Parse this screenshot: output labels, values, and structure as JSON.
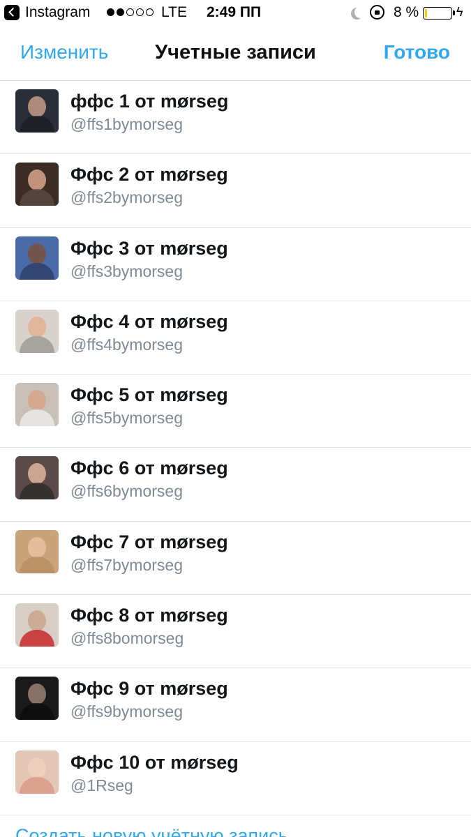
{
  "status_bar": {
    "back_app": "Instagram",
    "network": "LTE",
    "time": "2:49 ПП",
    "battery_percent": "8 %",
    "battery_level": 0.08,
    "charging_glyph": "ϟ",
    "icons": [
      "back-icon",
      "signal-icon",
      "moon-icon",
      "orientation-lock-icon",
      "battery-icon",
      "charging-icon"
    ]
  },
  "nav": {
    "edit": "Изменить",
    "title": "Учетные записи",
    "done": "Готово"
  },
  "accounts": [
    {
      "name": "ффс 1 от mørseg",
      "handle": "@ffs1bymorseg",
      "bg": "#2a2e38",
      "face": "#c69a86",
      "body": "#1b1d24"
    },
    {
      "name": "Ффс 2 от mørseg",
      "handle": "@ffs2bymorseg",
      "bg": "#3b2c26",
      "face": "#d9a68c",
      "body": "#5c4a44"
    },
    {
      "name": "Ффс 3 от mørseg",
      "handle": "@ffs3bymorseg",
      "bg": "#4b6aa8",
      "face": "#7a5040",
      "body": "#2c3d66"
    },
    {
      "name": "Ффс 4 от mørseg",
      "handle": "@ffs4bymorseg",
      "bg": "#d8d2cc",
      "face": "#e0b190",
      "body": "#9a9892"
    },
    {
      "name": "Ффс 5 от mørseg",
      "handle": "@ffs5bymorseg",
      "bg": "#c8bfb6",
      "face": "#d6a588",
      "body": "#eeeeee"
    },
    {
      "name": "Ффс 6 от mørseg",
      "handle": "@ffs6bymorseg",
      "bg": "#5a4a4a",
      "face": "#e1b59c",
      "body": "#2b2b2b"
    },
    {
      "name": "Ффс 7 от mørseg",
      "handle": "@ffs7bymorseg",
      "bg": "#c9a37a",
      "face": "#e8c2a2",
      "body": "#b98e62"
    },
    {
      "name": "Ффс 8 от mørseg",
      "handle": "@ffs8bomorseg",
      "bg": "#d7cfc6",
      "face": "#caa48c",
      "body": "#c81e22"
    },
    {
      "name": "Ффс 9 от mørseg",
      "handle": "@ffs9bymorseg",
      "bg": "#1a1a1a",
      "face": "#9b8072",
      "body": "#0b0b0b"
    },
    {
      "name": "Ффс 10 от mørseg",
      "handle": "@1Rseg",
      "bg": "#e4c6b6",
      "face": "#f0d0bd",
      "body": "#d89a86"
    }
  ],
  "create_account": "Создать новую учётную запись"
}
